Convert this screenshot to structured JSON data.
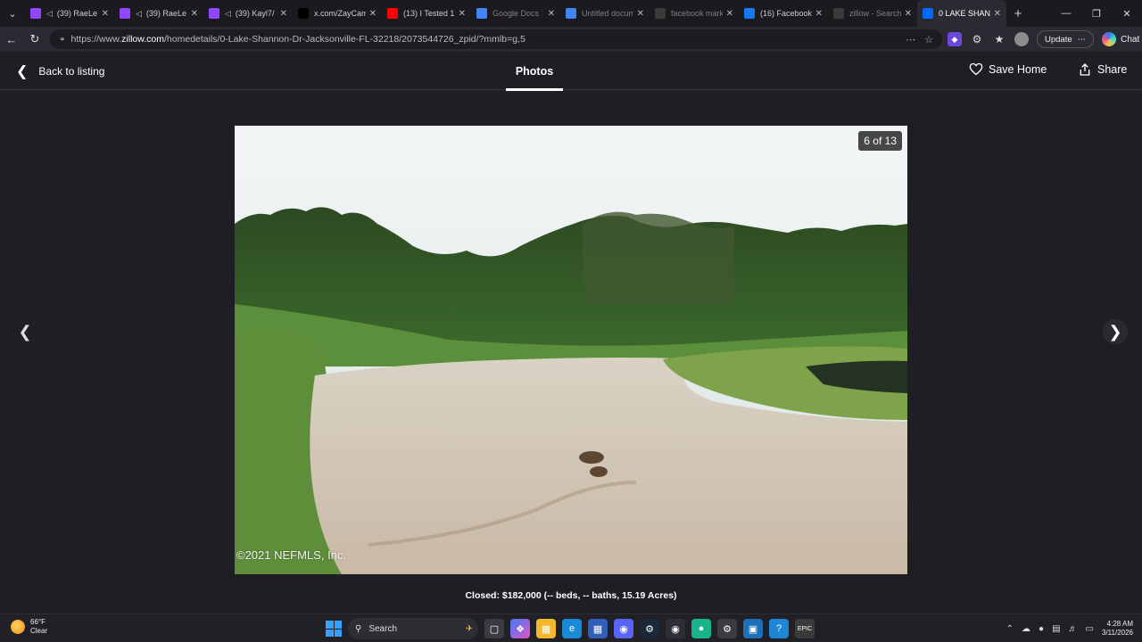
{
  "browser": {
    "tabs": [
      {
        "title": "(39) RaeLe",
        "icon": "twitch-icon",
        "color": "#9146ff",
        "muted": true,
        "active": false,
        "dim": false
      },
      {
        "title": "(39) RaeLe",
        "icon": "twitch-icon",
        "color": "#9146ff",
        "muted": true,
        "active": false,
        "dim": false
      },
      {
        "title": "(39) Kayl7/",
        "icon": "twitch-icon",
        "color": "#9146ff",
        "muted": true,
        "active": false,
        "dim": false
      },
      {
        "title": "x.com/ZayCam",
        "icon": "x-icon",
        "color": "#000000",
        "muted": false,
        "active": false,
        "dim": false
      },
      {
        "title": "(13) I Tested 1",
        "icon": "youtube-icon",
        "color": "#ff0000",
        "muted": false,
        "active": false,
        "dim": false
      },
      {
        "title": "Google Docs",
        "icon": "docs-icon",
        "color": "#4285f4",
        "muted": false,
        "active": false,
        "dim": true
      },
      {
        "title": "Untitled docum",
        "icon": "docs-icon",
        "color": "#4285f4",
        "muted": false,
        "active": false,
        "dim": true
      },
      {
        "title": "facebook mark",
        "icon": "search-icon",
        "color": "#3a3a3a",
        "muted": false,
        "active": false,
        "dim": true
      },
      {
        "title": "(16) Facebook",
        "icon": "facebook-icon",
        "color": "#1877f2",
        "muted": false,
        "active": false,
        "dim": false
      },
      {
        "title": "zillow - Search",
        "icon": "search-icon",
        "color": "#3a3a3a",
        "muted": false,
        "active": false,
        "dim": true
      },
      {
        "title": "0 LAKE SHANN",
        "icon": "zillow-icon",
        "color": "#006aff",
        "muted": false,
        "active": true,
        "dim": false
      }
    ],
    "url_prefix": "https://www.",
    "url_domain": "zillow.com",
    "url_path": "/homedetails/0-Lake-Shannon-Dr-Jacksonville-FL-32218/2073544726_zpid/?mmlb=g,5",
    "update_label": "Update",
    "chat_label": "Chat"
  },
  "viewer": {
    "back_label": "Back to listing",
    "tab_label": "Photos",
    "save_label": "Save Home",
    "share_label": "Share",
    "counter": "6 of 13",
    "copyright": "©2021 NEFMLS, Inc.",
    "caption": "Closed: $182,000 (-- beds, -- baths, 15.19 Acres)"
  },
  "taskbar": {
    "temperature": "66°F",
    "condition": "Clear",
    "search_placeholder": "Search",
    "time": "4:28 AM",
    "date": "3/11/2026"
  }
}
